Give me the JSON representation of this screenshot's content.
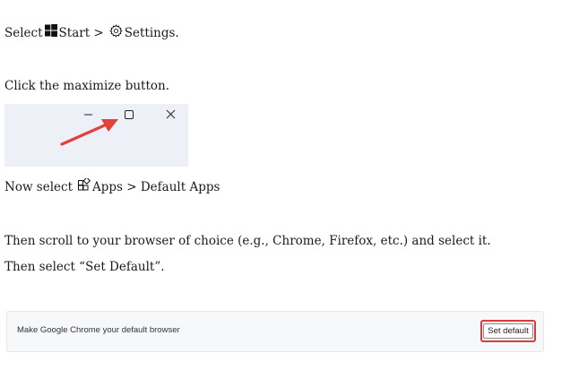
{
  "steps": {
    "step1": {
      "select": "Select",
      "start": "Start >",
      "settings": "Settings."
    },
    "step2": {
      "text": "Click the maximize button."
    },
    "step3": {
      "prefix": "Now select",
      "path": "Apps > Default Apps"
    },
    "step4": {
      "text": "Then scroll to your browser of choice (e.g., Chrome, Firefox, etc.) and select it."
    },
    "step5": {
      "text": "Then select “Set Default”."
    }
  },
  "banner": {
    "text": "Make Google Chrome your default browser",
    "button_label": "Set default"
  },
  "icons": {
    "windows": "windows-logo-icon",
    "settings": "gear-icon",
    "apps": "apps-icon",
    "minimize": "minimize-icon",
    "maximize": "maximize-icon",
    "close": "close-icon",
    "arrow": "red-arrow"
  },
  "colors": {
    "highlight_red": "#d93a3a",
    "illustration_bg": "#eef0f7"
  }
}
